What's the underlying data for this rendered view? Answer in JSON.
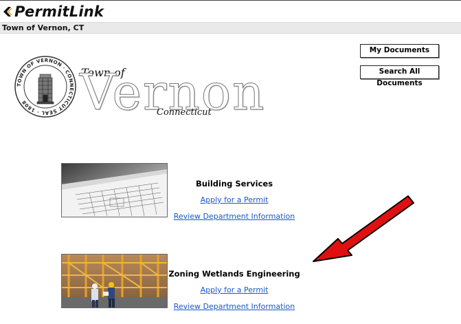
{
  "header": {
    "app_name": "PermitLink",
    "town": "Town of Vernon, CT"
  },
  "actions": {
    "my_documents": "My Documents",
    "search_all_documents": "Search All Documents"
  },
  "logo": {
    "town_of": "Town of",
    "name": "Vernon",
    "state": "Connecticut",
    "seal_text": "TOWN OF VERNON · CONNECTICUT SEAL · 1808"
  },
  "departments": [
    {
      "title": "Building Services",
      "apply_link": "Apply for a Permit",
      "info_link": "Review Department Information",
      "image": "blueprint-photo"
    },
    {
      "title": "Zoning Wetlands Engineering",
      "apply_link": "Apply for a Permit",
      "info_link": "Review Department Information",
      "image": "construction-workers-photo"
    }
  ],
  "annotation": {
    "arrow_color": "#e11010"
  }
}
